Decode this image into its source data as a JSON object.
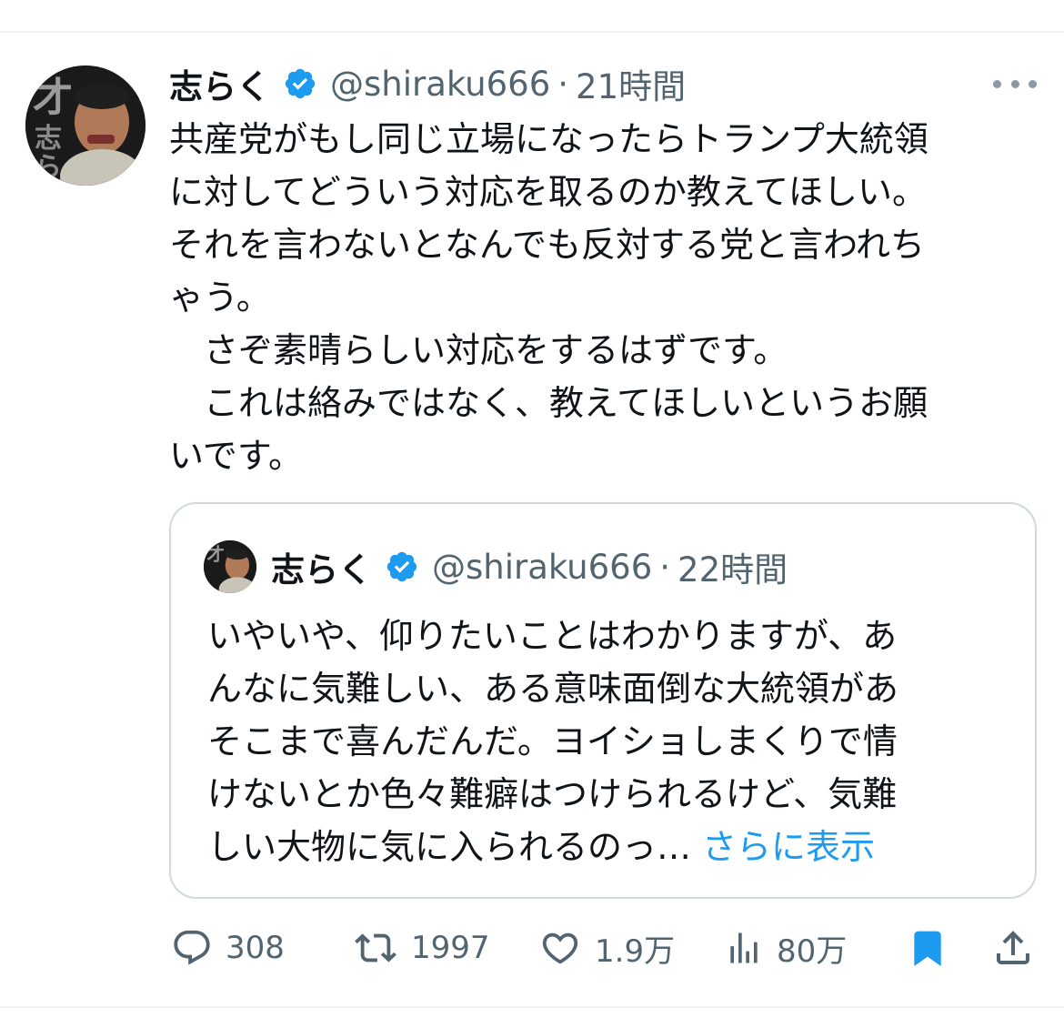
{
  "tweet": {
    "author": {
      "name": "志らく",
      "handle": "@shiraku666",
      "separator": "·",
      "time": "21時間",
      "avatar_icon": "avatar",
      "verified_icon": "verified-badge-icon"
    },
    "text_lines": [
      "共産党がもし同じ立場になったらトランプ大統領",
      "に対してどういう対応を取るのか教えてほしい。",
      "それを言わないとなんでも反対する党と言われち",
      "ゃう。",
      "　さぞ素晴らしい対応をするはずです。",
      "　これは絡みではなく、教えてほしいというお願",
      "いです。"
    ],
    "more_icon": "more-horizontal-icon"
  },
  "quoted_tweet": {
    "author": {
      "name": "志らく",
      "handle": "@shiraku666",
      "separator": "·",
      "time": "22時間"
    },
    "text_lines": [
      "いやいや、仰りたいことはわかりますが、あ",
      "んなに気難しい、ある意味面倒な大統領があ",
      "そこまで喜んだんだ。ヨイショしまくりで情",
      "けないとか色々難癖はつけられるけど、気難",
      "しい大物に気に入られるのっ…"
    ],
    "show_more": "さらに表示"
  },
  "actions": {
    "reply": {
      "icon": "reply-icon",
      "count": "308"
    },
    "retweet": {
      "icon": "retweet-icon",
      "count": "1997"
    },
    "like": {
      "icon": "heart-icon",
      "count": "1.9万"
    },
    "views": {
      "icon": "views-icon",
      "count": "80万"
    },
    "bookmark": {
      "icon": "bookmark-icon"
    },
    "share": {
      "icon": "share-icon"
    }
  },
  "colors": {
    "accent": "#1d9bf0",
    "text": "#0f1419",
    "secondary": "#536471",
    "border": "#cfd9de"
  }
}
